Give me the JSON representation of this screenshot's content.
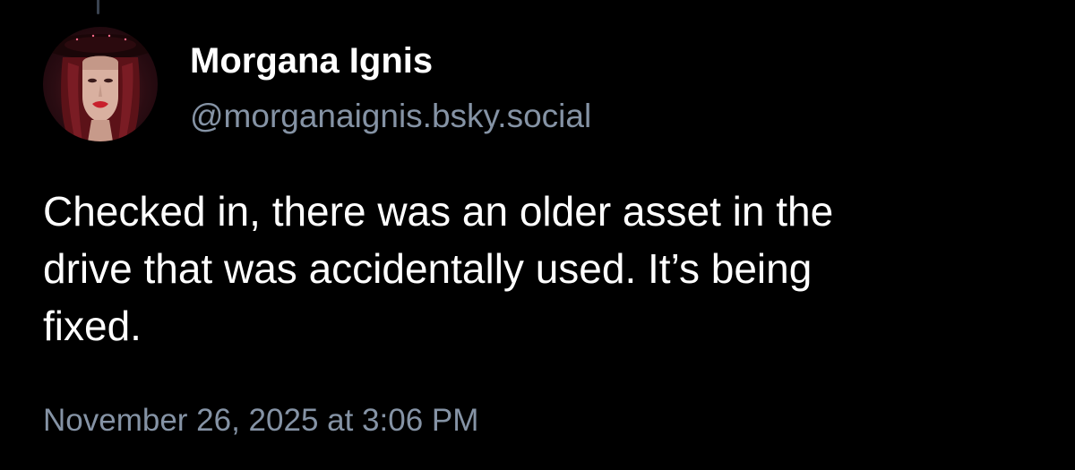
{
  "post": {
    "author": {
      "display_name": "Morgana Ignis",
      "handle": "@morganaignis.bsky.social",
      "avatar_icon": "user-avatar-portrait"
    },
    "text_lines": [
      "Checked in, there was an older asset in the",
      "drive that was accidentally used. It’s being",
      "fixed."
    ],
    "timestamp": "November 26, 2025 at 3:06 PM"
  },
  "theme": {
    "background": "#000000",
    "primary_text": "#ffffff",
    "secondary_text": "#8593a5",
    "thread_line": "#3a4350"
  }
}
